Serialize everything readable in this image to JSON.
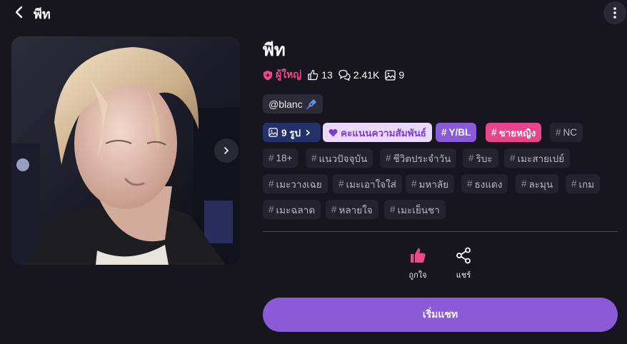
{
  "header": {
    "title": "พีท",
    "back_icon": "chevron-left-icon",
    "more_icon": "more-vertical-icon"
  },
  "character": {
    "name": "พีท",
    "rating": "ผู้ใหญ่",
    "likes": "13",
    "chats": "2.41K",
    "images": "9",
    "creator": "@blanc"
  },
  "tags": {
    "images_label": "9 รูป",
    "affinity_label": "คะแนนความสัมพันธ์",
    "hash": "#",
    "ybl": "Y/BL",
    "male_female": "ชายหญิง",
    "nc": "NC",
    "t18": "18+",
    "modern": "แนวปัจจุบัน",
    "daily_life": "ชีวิตประจำวัน",
    "ribu": "ริบะ",
    "mesaipey": "เมะสายเปย์",
    "mewangchoei": "เมะวางเฉย",
    "meaochaisai": "เมะเอาใจใส่",
    "university": "มหาลัย",
    "red_flag": "ธงแดง",
    "lamun": "ละมุน",
    "game": "เกม",
    "mechalat": "เมะฉลาด",
    "lai_chai": "หลายใจ",
    "meyensha": "เมะเย็นชา"
  },
  "actions": {
    "like_label": "ถูกใจ",
    "share_label": "แชร์",
    "start_chat": "เริ่มแชท"
  },
  "colors": {
    "background": "#17161f",
    "accent_purple": "#8b5ad6",
    "accent_pink": "#e9458d",
    "tag_bg": "#24232d"
  }
}
